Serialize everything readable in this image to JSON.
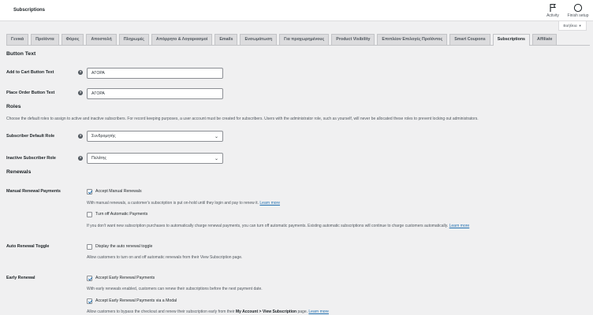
{
  "header": {
    "title": "Subscriptions",
    "activity_label": "Activity",
    "finish_label": "Finish setup"
  },
  "help_tab": {
    "label": "Βοήθεια"
  },
  "tabs": [
    {
      "label": "Γενικά",
      "active": false
    },
    {
      "label": "Προϊόντα",
      "active": false
    },
    {
      "label": "Φόρος",
      "active": false
    },
    {
      "label": "Αποστολή",
      "active": false
    },
    {
      "label": "Πληρωμές",
      "active": false
    },
    {
      "label": "Απόρρητο & Λογαριασμοί",
      "active": false
    },
    {
      "label": "Emails",
      "active": false
    },
    {
      "label": "Ενσωμάτωση",
      "active": false
    },
    {
      "label": "Για προχωρημένους",
      "active": false
    },
    {
      "label": "Product Visibility",
      "active": false
    },
    {
      "label": "Επιπλέον Επιλογές Προϊόντος",
      "active": false
    },
    {
      "label": "Smart Coupons",
      "active": false
    },
    {
      "label": "Subscriptions",
      "active": true
    },
    {
      "label": "Affiliate",
      "active": false
    }
  ],
  "button_text": {
    "heading": "Button Text",
    "add_to_cart_label": "Add to Cart Button Text",
    "add_to_cart_value": "ΑΓΟΡΑ",
    "place_order_label": "Place Order Button Text",
    "place_order_value": "ΑΓΟΡΑ"
  },
  "roles": {
    "heading": "Roles",
    "description": "Choose the default roles to assign to active and inactive subscribers. For record keeping purposes, a user account must be created for subscribers. Users with the administrator role, such as yourself, will never be allocated these roles to prevent locking out administrators.",
    "default_label": "Subscriber Default Role",
    "default_value": "Συνδρομητής",
    "inactive_label": "Inactive Subscriber Role",
    "inactive_value": "Πελάτης"
  },
  "renewals": {
    "heading": "Renewals",
    "manual_label": "Manual Renewal Payments",
    "accept_manual": "Accept Manual Renewals",
    "accept_manual_checked": true,
    "manual_desc": "With manual renewals, a customer's subscription is put on-hold until they login and pay to renew it.",
    "learn_more": "Learn more",
    "turn_off_auto": "Turn off Automatic Payments",
    "turn_off_auto_checked": false,
    "turn_off_desc": "If you don't want new subscription purchases to automatically charge renewal payments, you can turn off automatic payments. Existing automatic subscriptions will continue to charge customers automatically.",
    "auto_toggle_label": "Auto Renewal Toggle",
    "display_toggle": "Display the auto renewal toggle",
    "display_toggle_checked": false,
    "toggle_desc": "Allow customers to turn on and off automatic renewals from their View Subscription page.",
    "early_label": "Early Renewal",
    "accept_early": "Accept Early Renewal Payments",
    "accept_early_checked": true,
    "early_desc": "With early renewals enabled, customers can renew their subscriptions before the next payment date.",
    "accept_early_modal": "Accept Early Renewal Payments via a Modal",
    "accept_early_modal_checked": true,
    "modal_desc_pre": "Allow customers to bypass the checkout and renew their subscription early from their",
    "modal_desc_bold": "My Account > View Subscription",
    "modal_desc_post": "page."
  }
}
